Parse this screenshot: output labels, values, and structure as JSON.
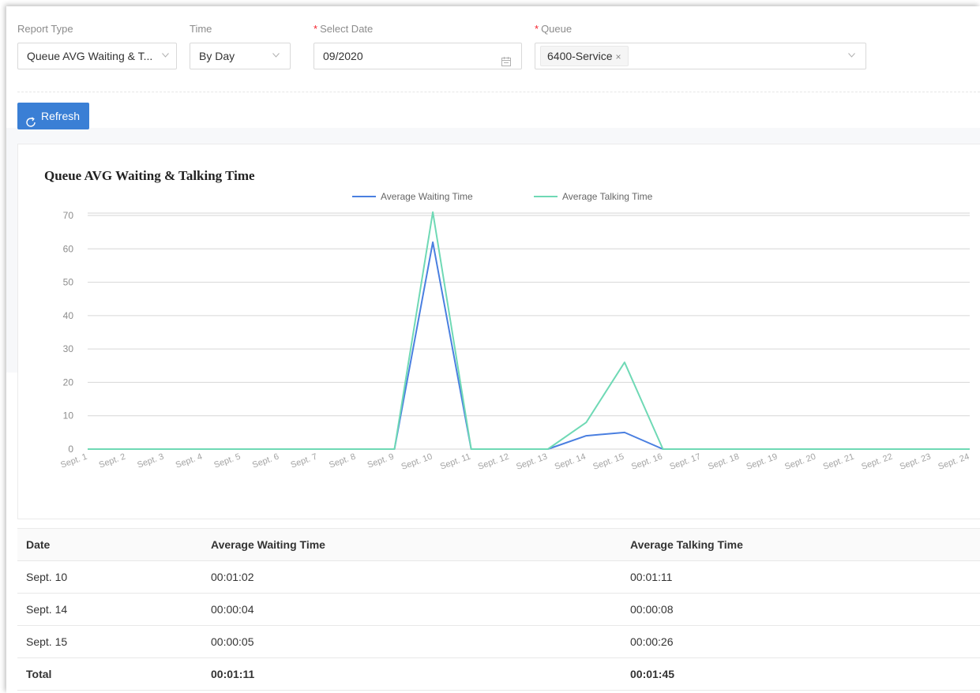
{
  "filters": {
    "report_type": {
      "label": "Report Type",
      "value": "Queue AVG Waiting & T..."
    },
    "time": {
      "label": "Time",
      "value": "By Day"
    },
    "select_date": {
      "label": "Select Date",
      "required_mark": "*",
      "value": "09/2020"
    },
    "queue": {
      "label": "Queue",
      "required_mark": "*",
      "tag": "6400-Service",
      "tag_close": "×"
    }
  },
  "toolbar": {
    "refresh_label": "Refresh"
  },
  "colors": {
    "waiting": "#4a7fe0",
    "talking": "#6fd9b5",
    "primary": "#3a7fd5"
  },
  "chart_data": {
    "type": "line",
    "title": "Queue AVG Waiting & Talking Time",
    "xlabel": "",
    "ylabel": "",
    "ylim": [
      0,
      70
    ],
    "yticks": [
      0,
      10,
      20,
      30,
      40,
      50,
      60,
      70
    ],
    "grid": true,
    "legend_position": "top-center",
    "categories": [
      "Sept. 1",
      "Sept. 2",
      "Sept. 3",
      "Sept. 4",
      "Sept. 5",
      "Sept. 6",
      "Sept. 7",
      "Sept. 8",
      "Sept. 9",
      "Sept. 10",
      "Sept. 11",
      "Sept. 12",
      "Sept. 13",
      "Sept. 14",
      "Sept. 15",
      "Sept. 16",
      "Sept. 17",
      "Sept. 18",
      "Sept. 19",
      "Sept. 20",
      "Sept. 21",
      "Sept. 22",
      "Sept. 23",
      "Sept. 24"
    ],
    "series": [
      {
        "name": "Average Waiting Time",
        "color": "#4a7fe0",
        "values": [
          0,
          0,
          0,
          0,
          0,
          0,
          0,
          0,
          0,
          62,
          0,
          0,
          0,
          4,
          5,
          0,
          0,
          0,
          0,
          0,
          0,
          0,
          0,
          0
        ]
      },
      {
        "name": "Average Talking Time",
        "color": "#6fd9b5",
        "values": [
          0,
          0,
          0,
          0,
          0,
          0,
          0,
          0,
          0,
          71,
          0,
          0,
          0,
          8,
          26,
          0,
          0,
          0,
          0,
          0,
          0,
          0,
          0,
          0
        ]
      }
    ]
  },
  "table": {
    "headers": [
      "Date",
      "Average Waiting Time",
      "Average Talking Time"
    ],
    "rows": [
      [
        "Sept. 10",
        "00:01:02",
        "00:01:11"
      ],
      [
        "Sept. 14",
        "00:00:04",
        "00:00:08"
      ],
      [
        "Sept. 15",
        "00:00:05",
        "00:00:26"
      ]
    ],
    "total": [
      "Total",
      "00:01:11",
      "00:01:45"
    ]
  }
}
